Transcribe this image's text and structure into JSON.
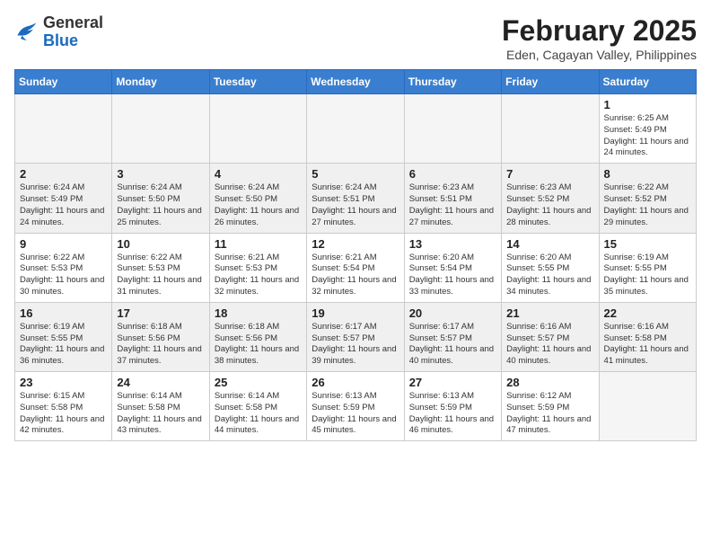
{
  "logo": {
    "general": "General",
    "blue": "Blue"
  },
  "title": {
    "month_year": "February 2025",
    "location": "Eden, Cagayan Valley, Philippines"
  },
  "weekdays": [
    "Sunday",
    "Monday",
    "Tuesday",
    "Wednesday",
    "Thursday",
    "Friday",
    "Saturday"
  ],
  "weeks": [
    [
      {
        "day": "",
        "info": ""
      },
      {
        "day": "",
        "info": ""
      },
      {
        "day": "",
        "info": ""
      },
      {
        "day": "",
        "info": ""
      },
      {
        "day": "",
        "info": ""
      },
      {
        "day": "",
        "info": ""
      },
      {
        "day": "1",
        "info": "Sunrise: 6:25 AM\nSunset: 5:49 PM\nDaylight: 11 hours and 24 minutes."
      }
    ],
    [
      {
        "day": "2",
        "info": "Sunrise: 6:24 AM\nSunset: 5:49 PM\nDaylight: 11 hours and 24 minutes."
      },
      {
        "day": "3",
        "info": "Sunrise: 6:24 AM\nSunset: 5:50 PM\nDaylight: 11 hours and 25 minutes."
      },
      {
        "day": "4",
        "info": "Sunrise: 6:24 AM\nSunset: 5:50 PM\nDaylight: 11 hours and 26 minutes."
      },
      {
        "day": "5",
        "info": "Sunrise: 6:24 AM\nSunset: 5:51 PM\nDaylight: 11 hours and 27 minutes."
      },
      {
        "day": "6",
        "info": "Sunrise: 6:23 AM\nSunset: 5:51 PM\nDaylight: 11 hours and 27 minutes."
      },
      {
        "day": "7",
        "info": "Sunrise: 6:23 AM\nSunset: 5:52 PM\nDaylight: 11 hours and 28 minutes."
      },
      {
        "day": "8",
        "info": "Sunrise: 6:22 AM\nSunset: 5:52 PM\nDaylight: 11 hours and 29 minutes."
      }
    ],
    [
      {
        "day": "9",
        "info": "Sunrise: 6:22 AM\nSunset: 5:53 PM\nDaylight: 11 hours and 30 minutes."
      },
      {
        "day": "10",
        "info": "Sunrise: 6:22 AM\nSunset: 5:53 PM\nDaylight: 11 hours and 31 minutes."
      },
      {
        "day": "11",
        "info": "Sunrise: 6:21 AM\nSunset: 5:53 PM\nDaylight: 11 hours and 32 minutes."
      },
      {
        "day": "12",
        "info": "Sunrise: 6:21 AM\nSunset: 5:54 PM\nDaylight: 11 hours and 32 minutes."
      },
      {
        "day": "13",
        "info": "Sunrise: 6:20 AM\nSunset: 5:54 PM\nDaylight: 11 hours and 33 minutes."
      },
      {
        "day": "14",
        "info": "Sunrise: 6:20 AM\nSunset: 5:55 PM\nDaylight: 11 hours and 34 minutes."
      },
      {
        "day": "15",
        "info": "Sunrise: 6:19 AM\nSunset: 5:55 PM\nDaylight: 11 hours and 35 minutes."
      }
    ],
    [
      {
        "day": "16",
        "info": "Sunrise: 6:19 AM\nSunset: 5:55 PM\nDaylight: 11 hours and 36 minutes."
      },
      {
        "day": "17",
        "info": "Sunrise: 6:18 AM\nSunset: 5:56 PM\nDaylight: 11 hours and 37 minutes."
      },
      {
        "day": "18",
        "info": "Sunrise: 6:18 AM\nSunset: 5:56 PM\nDaylight: 11 hours and 38 minutes."
      },
      {
        "day": "19",
        "info": "Sunrise: 6:17 AM\nSunset: 5:57 PM\nDaylight: 11 hours and 39 minutes."
      },
      {
        "day": "20",
        "info": "Sunrise: 6:17 AM\nSunset: 5:57 PM\nDaylight: 11 hours and 40 minutes."
      },
      {
        "day": "21",
        "info": "Sunrise: 6:16 AM\nSunset: 5:57 PM\nDaylight: 11 hours and 40 minutes."
      },
      {
        "day": "22",
        "info": "Sunrise: 6:16 AM\nSunset: 5:58 PM\nDaylight: 11 hours and 41 minutes."
      }
    ],
    [
      {
        "day": "23",
        "info": "Sunrise: 6:15 AM\nSunset: 5:58 PM\nDaylight: 11 hours and 42 minutes."
      },
      {
        "day": "24",
        "info": "Sunrise: 6:14 AM\nSunset: 5:58 PM\nDaylight: 11 hours and 43 minutes."
      },
      {
        "day": "25",
        "info": "Sunrise: 6:14 AM\nSunset: 5:58 PM\nDaylight: 11 hours and 44 minutes."
      },
      {
        "day": "26",
        "info": "Sunrise: 6:13 AM\nSunset: 5:59 PM\nDaylight: 11 hours and 45 minutes."
      },
      {
        "day": "27",
        "info": "Sunrise: 6:13 AM\nSunset: 5:59 PM\nDaylight: 11 hours and 46 minutes."
      },
      {
        "day": "28",
        "info": "Sunrise: 6:12 AM\nSunset: 5:59 PM\nDaylight: 11 hours and 47 minutes."
      },
      {
        "day": "",
        "info": ""
      }
    ]
  ]
}
